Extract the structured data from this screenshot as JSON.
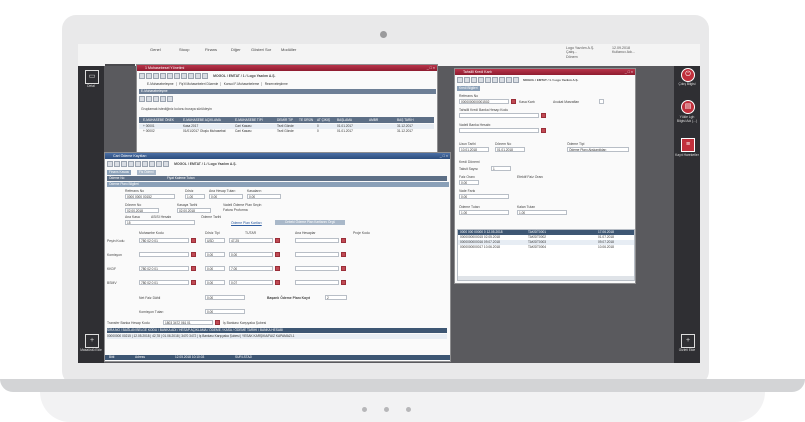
{
  "menubar": {
    "items": [
      "Genel",
      "Stoop",
      "Finans",
      "Diğer",
      "Gösteri Sor",
      "Modüller"
    ],
    "user_lines": [
      "Logo Yazılım A.Ş.",
      "Çalış...",
      "Dönem"
    ],
    "date_lines": [
      "12.09.2018",
      "Kullanıcı Adı..."
    ]
  },
  "left_rail": {
    "menu_label": "Menü",
    "top_item": "Detal",
    "bottom_item": "Masaüstü Ekle"
  },
  "right_rail": {
    "items": [
      "Çıkış Bilgisi",
      "Yükle Lgh Bilgisi Adı (...)",
      "Kayıt Hareketler"
    ],
    "bottom_item": "Gizleti Ekle"
  },
  "win_top": {
    "title": "1 Muhasebesel Yönetimi",
    "company": "MOGOL / EMTAT / 1 / Logo Yazılım A.Ş.",
    "subtoolbar": [
      "E-Muhasebeleşme",
      "Fiş'tl Muhasebeleri Düzenle",
      "Konsol F-Muhasebeleme",
      "Rezerveleştirme"
    ],
    "info_bar": "E-Muhasebeleşme",
    "search_caption": "Gruplamak istediğiniz kolonu buraya sürükleyin",
    "columns": [
      "E-MUHASEBE ÖNEK",
      "E-MUHASEBE AÇIKLAMA",
      "E-MUHASEBE TİPİ",
      "DEMİR TİP",
      "TE ÜRÜN",
      "AT ÇIKIŞ",
      "BAŞLAMA",
      "AMBR",
      "BAŞ TARİH"
    ],
    "rows": [
      [
        "+ 00001",
        "Kasa 2017",
        "Cari Kasası",
        "Tezil Gönde",
        "",
        "0",
        "01.01.2017",
        "",
        "31.12.2017"
      ],
      [
        "+ 00002",
        "01/01/2017 Oluşlu Muhasebat",
        "Cari Kasası",
        "Tezil Gönde",
        "",
        "0",
        "01.01.2017",
        "",
        "31.12.2017"
      ]
    ]
  },
  "win_main": {
    "title": "Cari Ödeme Kayıtları",
    "company": "MOGOL / EMTAT / 1 / Logo Yazılım A.Ş.",
    "tabs": [
      "Finans Kasası",
      "Fis Ödemi"
    ],
    "header_line1": "Ödeme No",
    "header_val1": "Fiyat Kaleme Tutarı",
    "section": "Ödeme Planı Bilgileri",
    "fields": {
      "receipt_label": "Referans No",
      "receipt_val": "0000 0000 00152",
      "currency_label": "Döviz",
      "currency_val": "1,00",
      "amount_label": "Ana Hesap Tutarı",
      "amount_val": "0,00",
      "rate_label": "Kasaların",
      "rate_val": "0,00",
      "date_label": "Dönem No",
      "date_val": "02.00.2018",
      "date2_label": "Kasaya Tarihi",
      "date2_val": "02.00.2018",
      "plan_label": "Vadeli Ödeme Plan Seçin",
      "plan_val": "Fatura Proforma",
      "total_label": "Ana Kasa",
      "total_val": "ASISI Hesabı",
      "doc_label": "Ödeme Tarihi",
      "doc_val": "15",
      "link1": "Ödeme Plan Kartları",
      "btn": "Cebeki Ödeme Plan Kartlarını Örgü"
    },
    "grid_headers": [
      "Muhasebe Kodu",
      "Döviz Tipi",
      "TUTAR",
      "Ana Hesaplar",
      "Proje Kodu"
    ],
    "grid_rows": [
      {
        "label": "Peşin Kodu",
        "code": "780 02 0 01",
        "cur": "USD",
        "amount": "47,25",
        "extra": ""
      },
      {
        "label": "Komisyon",
        "code": "",
        "cur": "0,00",
        "amount": "0,00",
        "extra": ""
      },
      {
        "label": "KKDF",
        "code": "780 02 0 01",
        "cur": "0,00",
        "amount": "7,00",
        "extra": ""
      },
      {
        "label": "BSMV",
        "code": "780 02 0 01",
        "cur": "0,00",
        "amount": "0,07",
        "extra": ""
      }
    ],
    "summary_label": "Net Faiz Dâhil",
    "summary_val": "0,00",
    "planned_label": "Başarılı Ödeme Planı Kayıt",
    "planned_val": "2",
    "commission_label": "Komisyon Tutarı",
    "commission_val": "0,00",
    "transfer_label": "Transfer Banka Hesap Kodu",
    "transfer_val": "1803 3472 061 01",
    "transfer_note": "İş Bankası Karşıyaka Şubesi",
    "bottom_columns": "SIRA NO / BAĞLAN BELGE KODU / BANKA ADI / HESAP AÇIKLAMA / ÖDEME / KASA / ÖDEME TARİHİ / BANKA HESABI",
    "bottom_row": "00000000 00215 | 12.05.2018 | 42,78 | 01.06.2018 | 3470 3472 | İş Bankası Karşıyaka Şubesi | YESAK KARŞIKA/FAİZ KAPAMAZI-1",
    "status": [
      "Bitti",
      "Adress",
      "12.05.2018 10:10:03",
      "SURİ-STAJI"
    ]
  },
  "win_right": {
    "title": "Tahsilli Kredi Kartı",
    "company": "MOGOL / EMTAT / 1 / Logo Yazılım A.Ş.",
    "tab": "Kredi Bilgileri",
    "ref_label": "Referans No",
    "ref_val": "0000000000001502",
    "kasa_label": "Kasa Kartı",
    "avukat_label": "Avukat Masrafları",
    "bank_label": "Tahsilli Kredi Banka Hesap Kodu",
    "credit_label": "Vadeli Banka Hesabı",
    "date_label": "Uzun Tarihi",
    "date_val": "10.01.2018",
    "dur_label": "Dönem No",
    "dur_val": "01.01.2018",
    "type_label": "Ödeme Tipi",
    "type_val": "Ödeme Planı Alışkanlıkları",
    "period_label": "Kredi Dönemi",
    "term_label": "Taksit Sayısı",
    "term_val": "1",
    "rate_label": "Faiz Oranı",
    "rate_val": "0,00",
    "eff_label": "Efektif Faiz Oranı",
    "iva_label": "Vade Farkı",
    "iva_val": "0,00",
    "pay_label": "Ödeme Tutarı",
    "pay_val": "1,00",
    "kalan_label": "Kalan Tutarı",
    "kalan_val": "1,00",
    "list_rows": [
      [
        "0000 000 00000 0 12.05.2018",
        "TAKSİT0001",
        "17.06.2018"
      ],
      [
        "0000000000015 02.05.2018",
        "TAKSİT0002",
        "01.07.2018"
      ],
      [
        "0000000000016 09.07.2018",
        "TAKSİT0003",
        "09.07.2018"
      ],
      [
        "0000000000017 10.06.2018",
        "TAKSİT0004",
        "10.06.2018"
      ]
    ]
  }
}
